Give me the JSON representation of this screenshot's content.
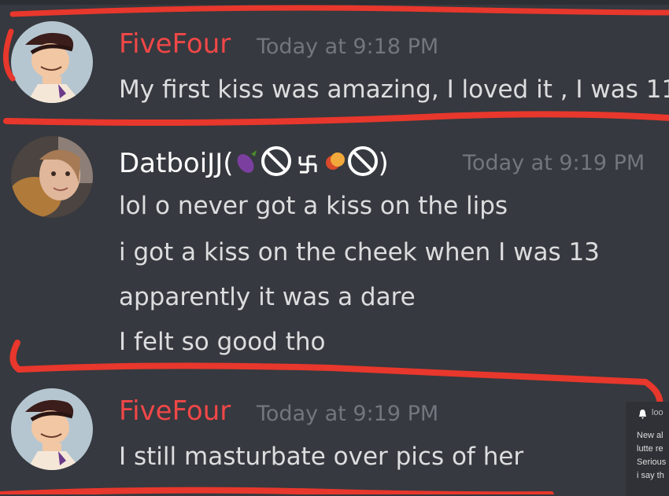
{
  "messages": [
    {
      "username": "FiveFour",
      "timestamp": "Today at 9:18 PM",
      "lines": [
        "My first kiss was amazing, I loved it , I was 11"
      ]
    },
    {
      "username_prefix": "DatboiJJ(",
      "username_suffix": ")",
      "timestamp": "Today at 9:19 PM",
      "lines": [
        "lol o never got a kiss on the lips",
        "i got a kiss on the cheek when I was 13",
        "apparently it was a dare",
        "I felt so good tho"
      ]
    },
    {
      "username": "FiveFour",
      "timestamp": "Today at 9:19 PM",
      "lines": [
        "I still masturbate over pics of her"
      ]
    }
  ],
  "notification": {
    "icon": "bell-icon",
    "head": "loo",
    "lines": [
      "New al",
      "lutte re",
      "Serious",
      "i say th"
    ]
  },
  "colors": {
    "background": "#36393f",
    "username_red": "#f04747",
    "timestamp": "#72767d",
    "text": "#dcddde",
    "scribble": "#e8372c"
  }
}
